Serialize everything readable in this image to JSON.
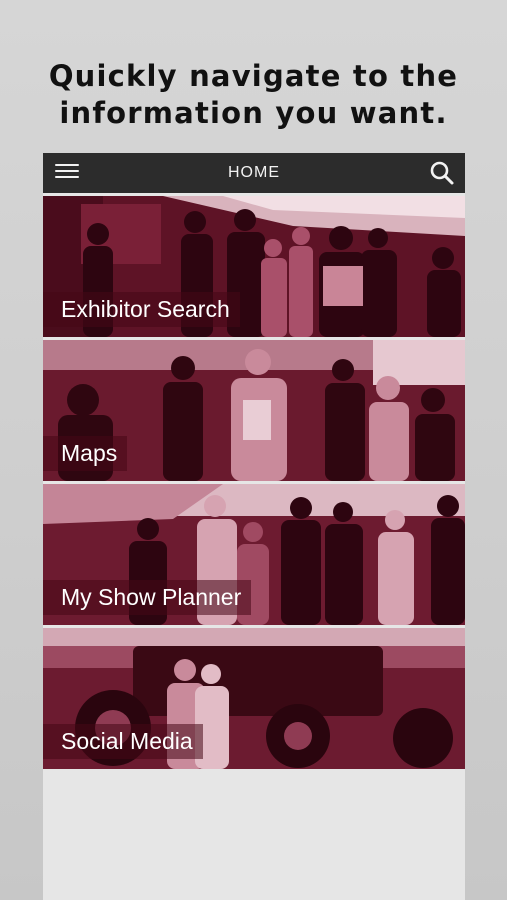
{
  "headline": {
    "line1": "Quickly navigate to the",
    "line2": "information you want."
  },
  "appbar": {
    "title": "HOME",
    "menu_icon": "hamburger-menu-icon",
    "search_icon": "search-icon",
    "background": "#2c2c2c"
  },
  "tiles": [
    {
      "label": "Exhibitor Search"
    },
    {
      "label": "Maps"
    },
    {
      "label": "My Show Planner"
    },
    {
      "label": "Social Media"
    }
  ],
  "colors": {
    "tile_tint": "#7a1e35",
    "tile_shadow": "#3a0612",
    "tile_highlight": "#e8c7cf",
    "page_background": "#d2d2d2"
  }
}
